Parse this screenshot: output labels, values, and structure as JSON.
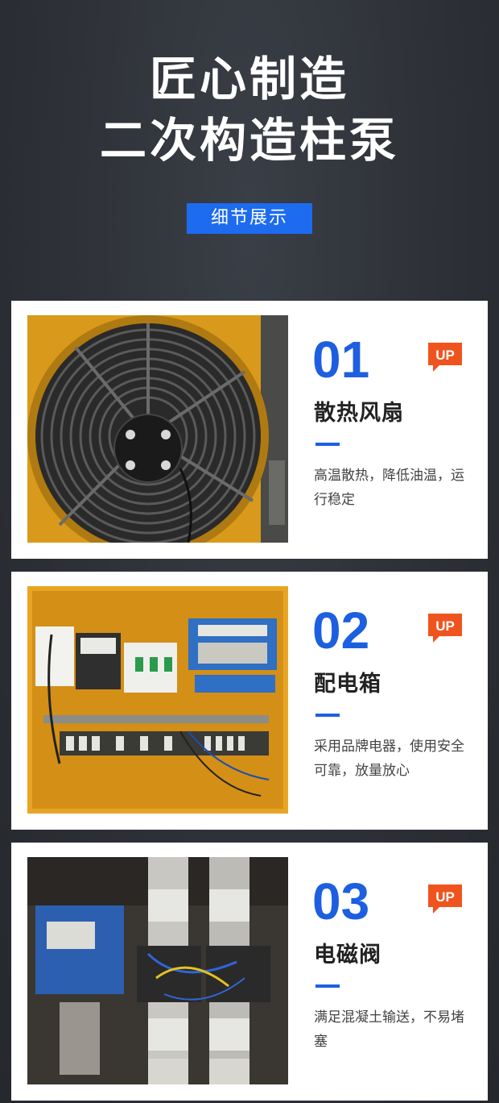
{
  "hero": {
    "line1": "匠心制造",
    "line2": "二次构造柱泵",
    "badge": "细节展示"
  },
  "cards": [
    {
      "number": "01",
      "up": "UP",
      "title": "散热风扇",
      "desc": "高温散热，降低油温，运行稳定"
    },
    {
      "number": "02",
      "up": "UP",
      "title": "配电箱",
      "desc": "采用品牌电器，使用安全可靠，放量放心"
    },
    {
      "number": "03",
      "up": "UP",
      "title": "电磁阀",
      "desc": "满足混凝土输送，不易堵塞"
    }
  ],
  "colors": {
    "accent": "#1d5fe0",
    "badge_bg": "#1d6cf0",
    "up_badge": "#f0541e",
    "background": "#2f3238",
    "machine_yellow": "#e8a524"
  }
}
